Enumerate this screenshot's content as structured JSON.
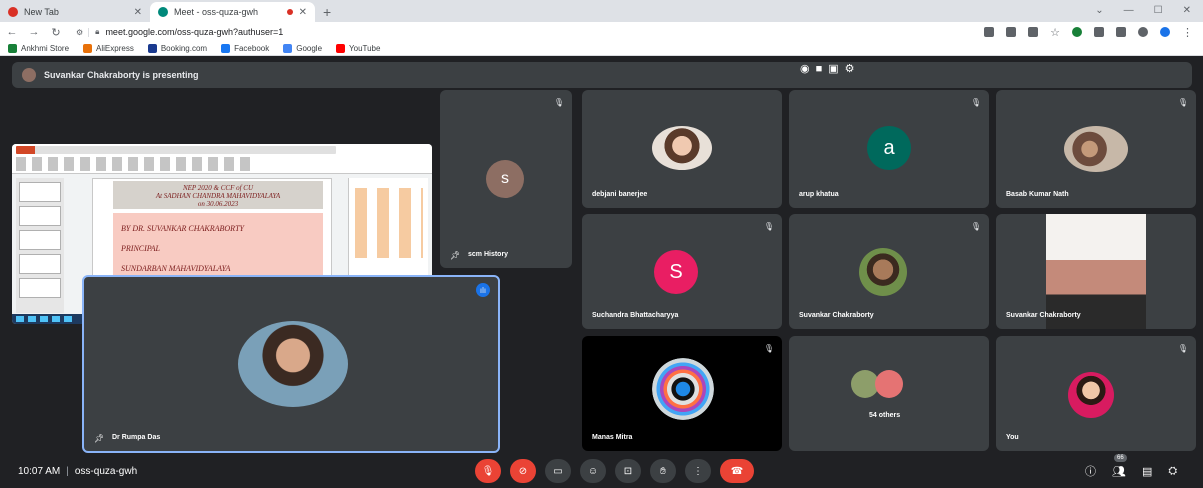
{
  "browser": {
    "tabs": [
      {
        "label": "New Tab",
        "active": false,
        "favicon_color": "#d93025"
      },
      {
        "label": "Meet - oss-quza-gwh",
        "active": true,
        "favicon_color": "#00897b"
      }
    ],
    "new_tab_glyph": "+",
    "url": "meet.google.com/oss-quza-gwh?authuser=1",
    "bookmarks": [
      {
        "label": "Ankhmi Store",
        "icon_color": "#188038"
      },
      {
        "label": "AliExpress",
        "icon_color": "#e8710a"
      },
      {
        "label": "Booking.com",
        "icon_color": "#1a3a8f"
      },
      {
        "label": "Facebook",
        "icon_color": "#1877f2"
      },
      {
        "label": "Google",
        "icon_color": "#4285f4"
      },
      {
        "label": "YouTube",
        "icon_color": "#ff0000"
      }
    ]
  },
  "meet": {
    "presenting_text": "Suvankar Chakraborty is presenting",
    "share": {
      "slide_line1": "NEP 2020 & CCF of CU",
      "slide_line2": "At SADHAN CHANDRA MAHAVIDYALAYA",
      "slide_line3": "on 30.06.2023",
      "slide_body1": "BY DR. SUVANKAR CHAKRABORTY",
      "slide_body2": "PRINCIPAL",
      "slide_body3": "SUNDARBAN MAHAVIDYALAYA"
    },
    "tiles": {
      "scm": {
        "name": "scm History",
        "initial": "s",
        "color": "#8d6e63"
      },
      "rumpa": {
        "name": "Dr Rumpa Das"
      },
      "debjani": {
        "name": "debjani banerjee"
      },
      "arup": {
        "name": "arup khatua",
        "initial": "a",
        "color": "#00695c"
      },
      "basab": {
        "name": "Basab Kumar Nath"
      },
      "suchandra": {
        "name": "Suchandra Bhattacharyya",
        "initial": "S",
        "color": "#e91e63"
      },
      "suvankar1": {
        "name": "Suvankar Chakraborty"
      },
      "suvankar2": {
        "name": "Suvankar Chakraborty"
      },
      "manas": {
        "name": "Manas Mitra"
      },
      "others": {
        "name": "54 others"
      },
      "you": {
        "name": "You"
      }
    },
    "time": "10:07 AM",
    "meeting_code": "oss-quza-gwh",
    "participant_count": "66"
  },
  "colors": {
    "accent": "#8ab4f8",
    "danger": "#ea4335",
    "tile": "#3c4043",
    "bg": "#202124"
  }
}
